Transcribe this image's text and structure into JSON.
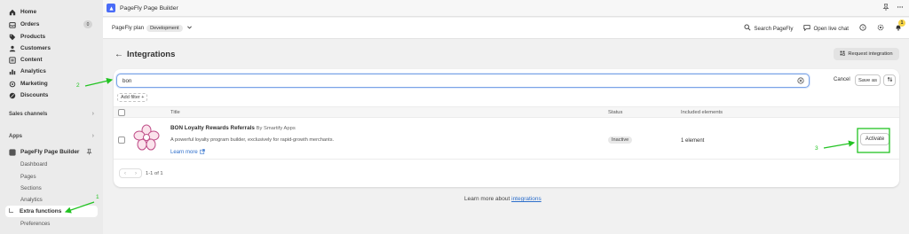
{
  "sidebar": {
    "items": [
      {
        "label": "Home",
        "icon": "home-icon"
      },
      {
        "label": "Orders",
        "icon": "orders-icon",
        "badge": "0"
      },
      {
        "label": "Products",
        "icon": "tag-icon"
      },
      {
        "label": "Customers",
        "icon": "person-icon"
      },
      {
        "label": "Content",
        "icon": "content-icon"
      },
      {
        "label": "Analytics",
        "icon": "analytics-icon"
      },
      {
        "label": "Marketing",
        "icon": "target-icon"
      },
      {
        "label": "Discounts",
        "icon": "discount-icon"
      }
    ],
    "sales_channels": "Sales channels",
    "apps": "Apps",
    "app_name": "PageFly Page Builder",
    "sub_items": [
      "Dashboard",
      "Pages",
      "Sections",
      "Analytics",
      "Extra functions",
      "Preferences"
    ],
    "active_sub_item": "Extra functions"
  },
  "topbar": {
    "app_title": "PageFly Page Builder"
  },
  "subbar": {
    "plan_label": "PageFly plan",
    "plan_badge": "Development",
    "search_label": "Search PageFly",
    "chat_label": "Open live chat",
    "notification_count": "1"
  },
  "page": {
    "title": "Integrations",
    "request_button": "Request integration"
  },
  "filters": {
    "search_value": "bon",
    "cancel_label": "Cancel",
    "save_as_label": "Save as",
    "add_filter_label": "Add filter +"
  },
  "table": {
    "columns": [
      "Title",
      "Status",
      "Included elements"
    ],
    "rows": [
      {
        "title": "BON Loyalty Rewards Referrals",
        "by": "By Smartify Apps",
        "description": "A powerful loyalty program builder, exclusively for rapid-growth merchants.",
        "learn_more": "Learn more",
        "status": "Inactive",
        "elements": "1 element",
        "action": "Activate"
      }
    ],
    "pagination": "1-1 of 1"
  },
  "footer": {
    "text": "Learn more about",
    "link": "integrations"
  },
  "annotations": [
    "1",
    "2",
    "3"
  ],
  "colors": {
    "accent_blue": "#2c6ecb",
    "annotation_green": "#22c322",
    "app_logo": "#4a6cf7"
  }
}
